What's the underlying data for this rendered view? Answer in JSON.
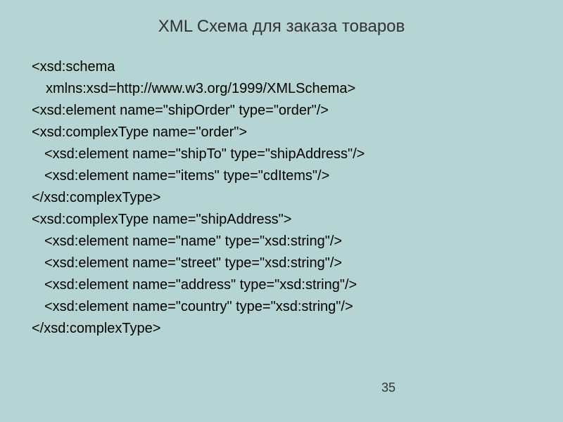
{
  "title": "XML Схема для заказа товаров",
  "code": {
    "l1": "<xsd:schema",
    "l2": "xmlns:xsd=http://www.w3.org/1999/XMLSchema>",
    "l3": "<xsd:element name=\"shipOrder\" type=\"order\"/>",
    "l4": "<xsd:complexType name=\"order\">",
    "l5": "<xsd:element name=\"shipTo\" type=\"shipAddress\"/>",
    "l6": "<xsd:element name=\"items\" type=\"cdItems\"/>",
    "l7": "</xsd:complexType>",
    "l8": "<xsd:complexType name=\"shipAddress\">",
    "l9": "<xsd:element name=\"name\" type=\"xsd:string\"/>",
    "l10": "<xsd:element name=\"street\" type=\"xsd:string\"/>",
    "l11": "<xsd:element name=\"address\" type=\"xsd:string\"/>",
    "l12": "<xsd:element name=\"country\" type=\"xsd:string\"/>",
    "l13": "</xsd:complexType>"
  },
  "pageNumber": "35"
}
